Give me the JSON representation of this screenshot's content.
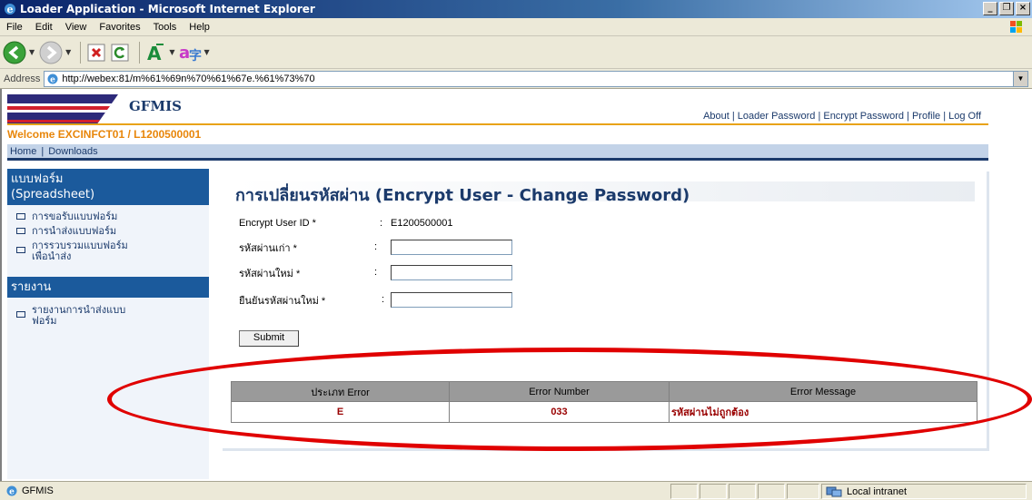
{
  "window": {
    "title": "Loader Application - Microsoft Internet Explorer",
    "minimize": "_",
    "maximize": "❐",
    "close": "×"
  },
  "menu": [
    "File",
    "Edit",
    "View",
    "Favorites",
    "Tools",
    "Help"
  ],
  "address": {
    "label": "Address",
    "url": "http://webex:81/m%61%69n%70%61%67e.%61%73%70"
  },
  "site": {
    "title": "GFMIS",
    "top_links": "About | Loader Password | Encrypt Password | Profile | Log Off",
    "welcome": "Welcome  EXCINFCT01 / L1200500001",
    "nav": [
      "Home",
      "Downloads"
    ]
  },
  "sidebar": {
    "section1_title_line1": "แบบฟอร์ม",
    "section1_title_line2": "(Spreadsheet)",
    "section1_items": [
      "การขอรับแบบฟอร์ม",
      "การนำส่งแบบฟอร์ม",
      "การรวบรวมแบบฟอร์ม",
      "เพื่อนำส่ง"
    ],
    "section2_title": "รายงาน",
    "section2_items": [
      "รายงานการนำส่งแบบ",
      "ฟอร์ม"
    ]
  },
  "form": {
    "title": "การเปลี่ยนรหัสผ่าน (Encrypt User - Change Password)",
    "user_id_label": "Encrypt User ID *",
    "user_id_value": "E1200500001",
    "old_password_label": "รหัสผ่านเก่า *",
    "new_password_label": "รหัสผ่านใหม่ *",
    "confirm_password_label": "ยืนยันรหัสผ่านใหม่ *",
    "colon": ":",
    "submit": "Submit"
  },
  "errors": {
    "headers": [
      "ประเภท Error",
      "Error Number",
      "Error Message"
    ],
    "rows": [
      [
        "E",
        "033",
        "รหัสผ่านไม่ถูกต้อง"
      ]
    ]
  },
  "status": {
    "left": "GFMIS",
    "zone": "Local intranet"
  },
  "colors": {
    "annotation": "#e00000",
    "brand_blue": "#1b3a6b",
    "accent_orange": "#e8a317"
  }
}
